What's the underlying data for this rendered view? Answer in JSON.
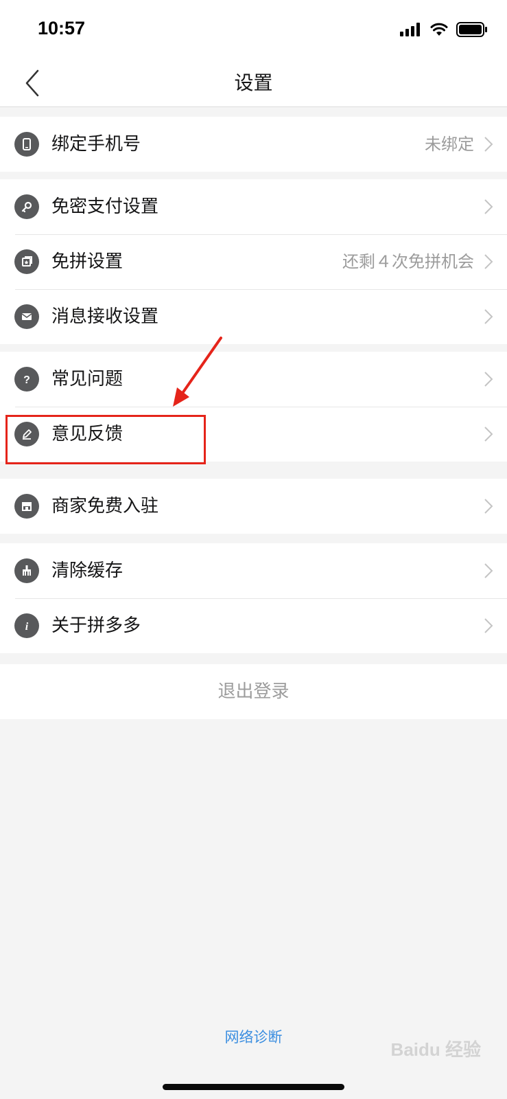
{
  "status": {
    "time": "10:57"
  },
  "header": {
    "title": "设置"
  },
  "groups": [
    {
      "items": [
        {
          "icon": "phone-icon",
          "label": "绑定手机号",
          "value": "未绑定"
        }
      ]
    },
    {
      "items": [
        {
          "icon": "key-icon",
          "label": "免密支付设置",
          "value": ""
        },
        {
          "icon": "ticket-icon",
          "label": "免拼设置",
          "value": "还剩４次免拼机会"
        },
        {
          "icon": "mail-icon",
          "label": "消息接收设置",
          "value": ""
        }
      ]
    },
    {
      "items": [
        {
          "icon": "question-icon",
          "label": "常见问题",
          "value": ""
        },
        {
          "icon": "pencil-icon",
          "label": "意见反馈",
          "value": ""
        }
      ]
    },
    {
      "items": [
        {
          "icon": "store-icon",
          "label": "商家免费入驻",
          "value": ""
        }
      ]
    },
    {
      "items": [
        {
          "icon": "broom-icon",
          "label": "清除缓存",
          "value": ""
        },
        {
          "icon": "info-icon",
          "label": "关于拼多多",
          "value": ""
        }
      ]
    }
  ],
  "logout_label": "退出登录",
  "network_diagnose": "网络诊断",
  "watermark": "Baidu 经验",
  "colors": {
    "accent": "#e5241a",
    "link": "#3b8ee0",
    "icon_bg": "#58595b",
    "background": "#f4f4f4"
  }
}
